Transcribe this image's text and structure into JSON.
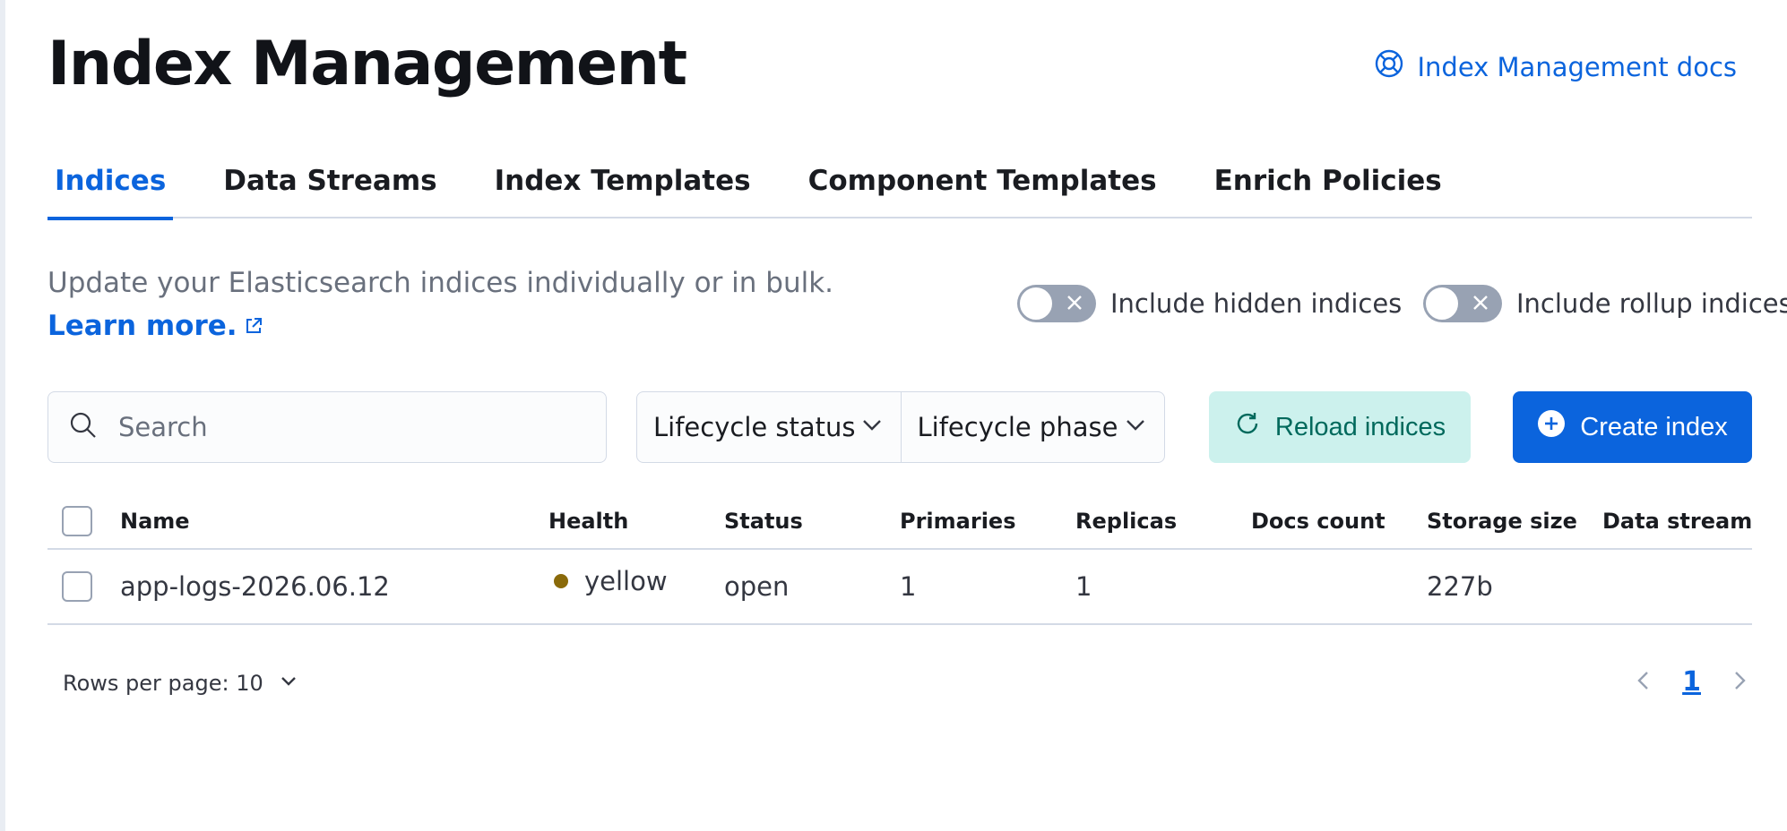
{
  "header": {
    "title": "Index Management",
    "docs_link": "Index Management docs"
  },
  "tabs": [
    {
      "label": "Indices",
      "active": true
    },
    {
      "label": "Data Streams",
      "active": false
    },
    {
      "label": "Index Templates",
      "active": false
    },
    {
      "label": "Component Templates",
      "active": false
    },
    {
      "label": "Enrich Policies",
      "active": false
    }
  ],
  "description": {
    "text": "Update your Elasticsearch indices individually or in bulk.",
    "learn_more": "Learn more."
  },
  "toggles": {
    "hidden": {
      "label": "Include hidden indices",
      "on": false
    },
    "rollup": {
      "label": "Include rollup indices",
      "on": false
    }
  },
  "toolbar": {
    "search_placeholder": "Search",
    "filter_lifecycle_status": "Lifecycle status",
    "filter_lifecycle_phase": "Lifecycle phase",
    "reload_label": "Reload indices",
    "create_label": "Create index"
  },
  "table": {
    "columns": [
      "Name",
      "Health",
      "Status",
      "Primaries",
      "Replicas",
      "Docs count",
      "Storage size",
      "Data stream"
    ],
    "rows": [
      {
        "name": "app-logs-2026.06.12",
        "health": "yellow",
        "status": "open",
        "primaries": "1",
        "replicas": "1",
        "docs_count": "",
        "storage_size": "227b",
        "data_stream": ""
      }
    ]
  },
  "pagination": {
    "rows_per_page": "Rows per page: 10",
    "current_page": "1"
  },
  "colors": {
    "primary": "#0b64dd",
    "reload_bg": "#ccf1ed",
    "reload_text": "#00695c",
    "health_yellow": "#8a6a0a"
  }
}
